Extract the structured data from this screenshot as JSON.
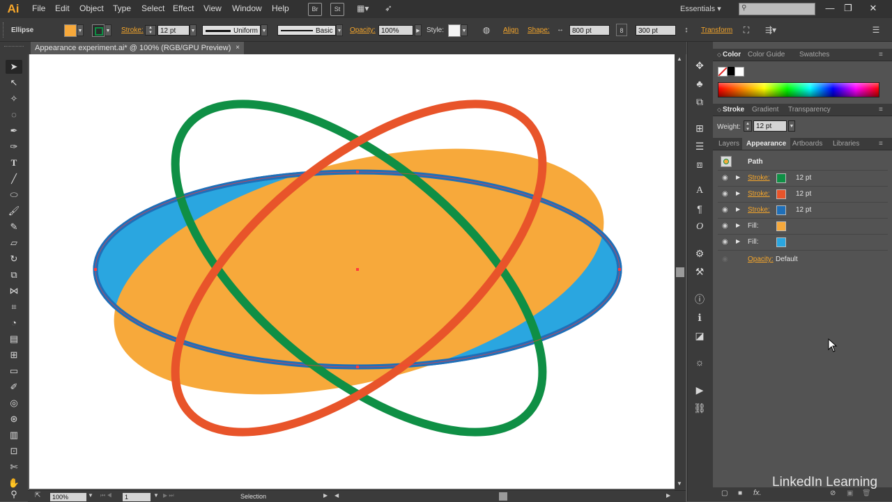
{
  "app": {
    "logo": "Ai"
  },
  "menu": [
    "File",
    "Edit",
    "Object",
    "Type",
    "Select",
    "Effect",
    "View",
    "Window",
    "Help"
  ],
  "menubar_buttons": [
    "Br",
    "St"
  ],
  "workspace": "Essentials",
  "control_bar": {
    "object_type": "Ellipse",
    "fill_color": "#f7a93b",
    "stroke_color": "#0f8f45",
    "stroke_label": "Stroke:",
    "stroke_weight": "12 pt",
    "profile": "Uniform",
    "brush": "Basic",
    "opacity_label": "Opacity:",
    "opacity_value": "100%",
    "style_label": "Style:",
    "align_label": "Align",
    "shape_label": "Shape:",
    "width_value": "800 pt",
    "height_value": "300 pt",
    "transform_label": "Transform"
  },
  "document_tab": {
    "title": "Appearance experiment.ai* @ 100% (RGB/GPU Preview)",
    "close": "×"
  },
  "status_bar": {
    "zoom": "100%",
    "artboard": "1",
    "tool": "Selection"
  },
  "color_panel": {
    "tabs": [
      "Color",
      "Color Guide",
      "Swatches"
    ],
    "active": "Color"
  },
  "stroke_panel": {
    "tabs": [
      "Stroke",
      "Gradient",
      "Transparency"
    ],
    "weight_label": "Weight:",
    "weight_value": "12 pt"
  },
  "appearance_panel": {
    "tabs": [
      "Layers",
      "Appearance",
      "Artboards",
      "Libraries"
    ],
    "active": "Appearance",
    "header": "Path",
    "rows": [
      {
        "label": "Stroke:",
        "color": "#0f8f45",
        "value": "12 pt"
      },
      {
        "label": "Stroke:",
        "color": "#e8542a",
        "value": "12 pt"
      },
      {
        "label": "Stroke:",
        "color": "#1f6fb8",
        "value": "12 pt"
      },
      {
        "label": "Fill:",
        "color": "#f7a93b",
        "value": ""
      },
      {
        "label": "Fill:",
        "color": "#2aa6e0",
        "value": ""
      }
    ],
    "opacity_label": "Opacity:",
    "opacity_value": "Default"
  },
  "watermark": "LinkedIn Learning",
  "art_colors": {
    "orange": "#f7a93b",
    "blue": "#2aa6e0",
    "blue_stroke": "#1f6fb8",
    "green": "#0f8f45",
    "red": "#e8542a"
  }
}
